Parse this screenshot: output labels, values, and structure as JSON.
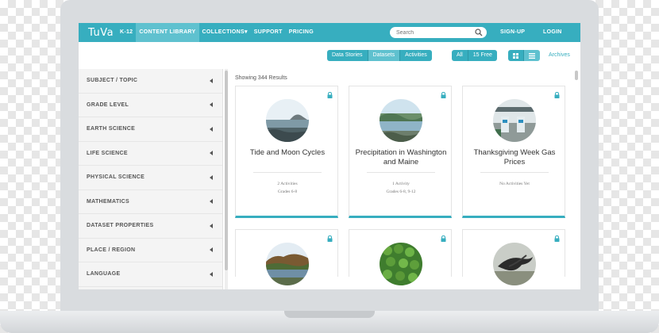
{
  "header": {
    "logo": "TuVa",
    "nav": [
      "K-12",
      "CONTENT LIBRARY",
      "COLLECTIONS▾",
      "SUPPORT",
      "PRICING"
    ],
    "active_nav": "CONTENT LIBRARY",
    "search_placeholder": "Search",
    "signup": "SIGN-UP",
    "login": "LOGIN"
  },
  "toolbar": {
    "types": [
      "Data Stories",
      "Datasets",
      "Activities"
    ],
    "selected_type": "Datasets",
    "filters": [
      "All",
      "15 Free"
    ],
    "view_icons": [
      "grid-view-icon",
      "list-view-icon"
    ],
    "archives": "Archives"
  },
  "sidebar": {
    "filters": [
      "SUBJECT / TOPIC",
      "GRADE LEVEL",
      "EARTH SCIENCE",
      "LIFE SCIENCE",
      "PHYSICAL SCIENCE",
      "MATHEMATICS",
      "DATASET PROPERTIES",
      "PLACE / REGION",
      "LANGUAGE"
    ]
  },
  "results": {
    "summary": "Showing 344 Results"
  },
  "cards": [
    {
      "title": "Tide and Moon Cycles",
      "meta1": "2 Activities",
      "meta2": "Grades 6-8",
      "locked": true,
      "image": "coastline-photo"
    },
    {
      "title": "Precipitation in Washington and Maine",
      "meta1": "1 Activity",
      "meta2": "Grades 6-8, 9-12",
      "locked": true,
      "image": "lake-photo"
    },
    {
      "title": "Thanksgiving Week Gas Prices",
      "meta1": "No Activities Yet",
      "meta2": "",
      "locked": true,
      "image": "gas-station-photo"
    },
    {
      "title": "",
      "locked": true,
      "image": "river-photo"
    },
    {
      "title": "",
      "locked": true,
      "image": "moss-photo"
    },
    {
      "title": "",
      "locked": true,
      "image": "bird-photo"
    }
  ],
  "colors": {
    "accent": "#37aebf",
    "accent_light": "#5fc1cf"
  }
}
